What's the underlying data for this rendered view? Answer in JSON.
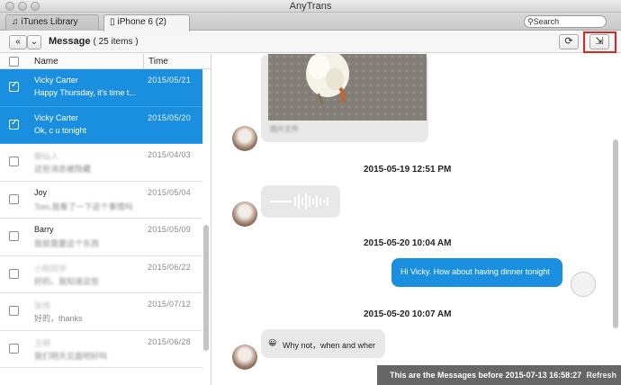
{
  "window": {
    "title": "AnyTrans"
  },
  "tabs": [
    {
      "label": "iTunes Library",
      "icon": "music-note-icon"
    },
    {
      "label": "iPhone 6 (2)",
      "icon": "phone-icon"
    }
  ],
  "search": {
    "placeholder": "Search"
  },
  "toolbar": {
    "title": "Message",
    "count": "( 25 items )"
  },
  "list": {
    "columns": {
      "name": "Name",
      "time": "Time"
    },
    "rows": [
      {
        "name": "Vicky Carter",
        "preview": "Happy Thursday, it's time t...",
        "time": "2015/05/21",
        "selected": true
      },
      {
        "name": "Vicky Carter",
        "preview": "Ok, c u tonight",
        "time": "2015/05/20",
        "selected": true
      },
      {
        "name": "朝仙人",
        "preview": "这些消息被隐藏",
        "time": "2015/04/03",
        "selected": false
      },
      {
        "name": "Joy",
        "preview": "Tom,我看了一下这个事情吗",
        "time": "2015/05/04",
        "selected": false
      },
      {
        "name": "Barry",
        "preview": "我就需要这个东西",
        "time": "2015/05/09",
        "selected": false
      },
      {
        "name": "小刚同学",
        "preview": "好的，我知道这些",
        "time": "2015/06/22",
        "selected": false
      },
      {
        "name": "张伟",
        "preview": "好的，thanks",
        "time": "2015/07/12",
        "selected": false
      },
      {
        "name": "王明",
        "preview": "我们明天见面吧好吗",
        "time": "2015/06/28",
        "selected": false
      }
    ],
    "blurred_text_note": ""
  },
  "chat": {
    "image_caption": "图片文件",
    "timestamps": [
      "2015-05-19 12:51 PM",
      "2015-05-20 10:04 AM",
      "2015-05-20 10:07 AM"
    ],
    "outgoing": "Hi Vicky. How about having dinner tonight",
    "incoming_last": "Why not，when and wher",
    "incoming_last_emoji": "😀"
  },
  "bottom_bar": {
    "message": "This are the Messages before 2015-07-13 16:58:27",
    "refresh": "Refresh"
  },
  "colors": {
    "selection": "#1a8fe0",
    "highlight": "#e0261c"
  }
}
